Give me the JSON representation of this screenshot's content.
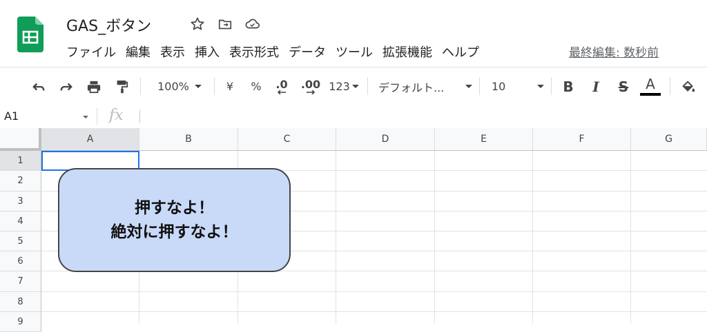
{
  "document": {
    "title": "GAS_ボタン",
    "last_edit": "最終編集: 数秒前"
  },
  "menu": [
    "ファイル",
    "編集",
    "表示",
    "挿入",
    "表示形式",
    "データ",
    "ツール",
    "拡張機能",
    "ヘルプ"
  ],
  "toolbar": {
    "zoom": "100%",
    "currency": "¥",
    "percent": "%",
    "dec_decrease": ".0",
    "dec_increase": ".00",
    "format_more": "123",
    "font": "デフォルト...",
    "font_size": "10",
    "bold": "B",
    "italic": "I",
    "strike": "S",
    "text_color": "A"
  },
  "formula_bar": {
    "cell_ref": "A1",
    "fx": "fx"
  },
  "columns": [
    "A",
    "B",
    "C",
    "D",
    "E",
    "F",
    "G"
  ],
  "rows": [
    "1",
    "2",
    "3",
    "4",
    "5",
    "6",
    "7",
    "8",
    "9"
  ],
  "drawing": {
    "line1": "押すなよ！",
    "line2": "絶対に押すなよ！",
    "fill": "#c9daf8"
  },
  "colors": {
    "sheets_green": "#0f9d58",
    "selection": "#1a73e8"
  }
}
